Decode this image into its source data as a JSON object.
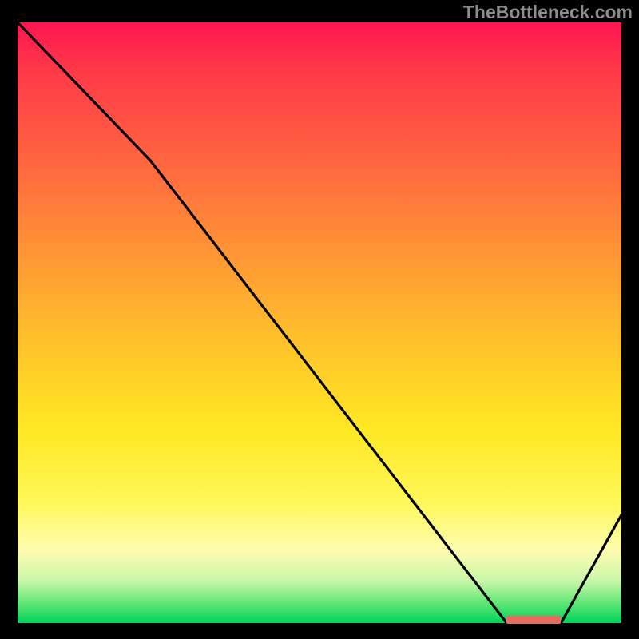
{
  "attribution": "TheBottleneck.com",
  "chart_data": {
    "type": "line",
    "title": "",
    "xlabel": "",
    "ylabel": "",
    "xlim": [
      0,
      100
    ],
    "ylim": [
      0,
      100
    ],
    "series": [
      {
        "name": "bottleneck-curve",
        "x": [
          0,
          22,
          81,
          83,
          90,
          100
        ],
        "y": [
          100,
          77,
          0,
          0,
          0,
          18
        ]
      }
    ],
    "annotations": [
      {
        "name": "optimal-range",
        "x_start": 81,
        "x_end": 90,
        "y": 0
      }
    ],
    "legend": false,
    "grid": false
  },
  "colors": {
    "background": "#000000",
    "curve": "#000000",
    "marker": "#e96a5e",
    "gradient_top": "#ff1552",
    "gradient_bottom": "#00d35a",
    "attribution_text": "#8c8c8c"
  }
}
